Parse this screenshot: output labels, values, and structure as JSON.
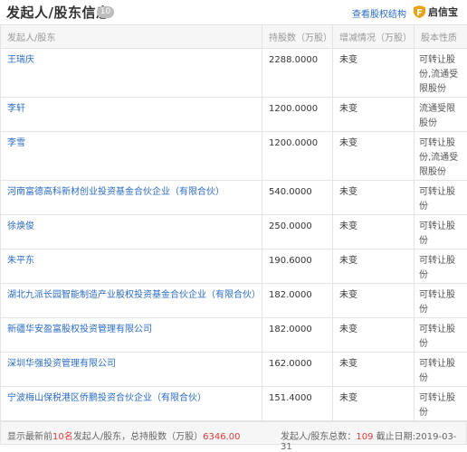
{
  "header": {
    "title": "发起人/股东信息",
    "count": "10",
    "equity_link": "查看股权结构",
    "brand": "启信宝"
  },
  "table": {
    "columns": [
      "发起人/股东",
      "持股数（万股）",
      "增减情况（万股）",
      "股本性质"
    ],
    "rows": [
      {
        "name": "王瑞庆",
        "shares": "2288.0000",
        "change": "未变",
        "nature": "可转让股份,流通受限股份"
      },
      {
        "name": "李轩",
        "shares": "1200.0000",
        "change": "未变",
        "nature": "流通受限股份"
      },
      {
        "name": "李雪",
        "shares": "1200.0000",
        "change": "未变",
        "nature": "可转让股份,流通受限股份"
      },
      {
        "name": "河南富德高科新材创业投资基金合伙企业（有限合伙）",
        "shares": "540.0000",
        "change": "未变",
        "nature": "可转让股份"
      },
      {
        "name": "徐焕俊",
        "shares": "250.0000",
        "change": "未变",
        "nature": "可转让股份"
      },
      {
        "name": "朱平东",
        "shares": "190.6000",
        "change": "未变",
        "nature": "可转让股份"
      },
      {
        "name": "湖北九派长园智能制造产业股权投资基金合伙企业（有限合伙）",
        "shares": "182.0000",
        "change": "未变",
        "nature": "可转让股份"
      },
      {
        "name": "新疆华安盈富股权投资管理有限公司",
        "shares": "182.0000",
        "change": "未变",
        "nature": "可转让股份"
      },
      {
        "name": "深圳华强投资管理有限公司",
        "shares": "162.0000",
        "change": "未变",
        "nature": "可转让股份"
      },
      {
        "name": "宁波梅山保税港区侨鹏投资合伙企业（有限合伙）",
        "shares": "151.4000",
        "change": "未变",
        "nature": "可转让股份"
      }
    ]
  },
  "footer": {
    "left_prefix": "显示最新前",
    "left_count": "10名",
    "left_middle": "发起人/股东，总持股数（万股）",
    "left_total": "6346.00",
    "right_prefix": "发起人/股东总数：",
    "right_total": "109",
    "right_date": "截止日期:2019-03-31"
  },
  "colors": {
    "link": "#2b6cc4",
    "highlight": "#e4393c",
    "brand_icon": "#e8a317"
  }
}
